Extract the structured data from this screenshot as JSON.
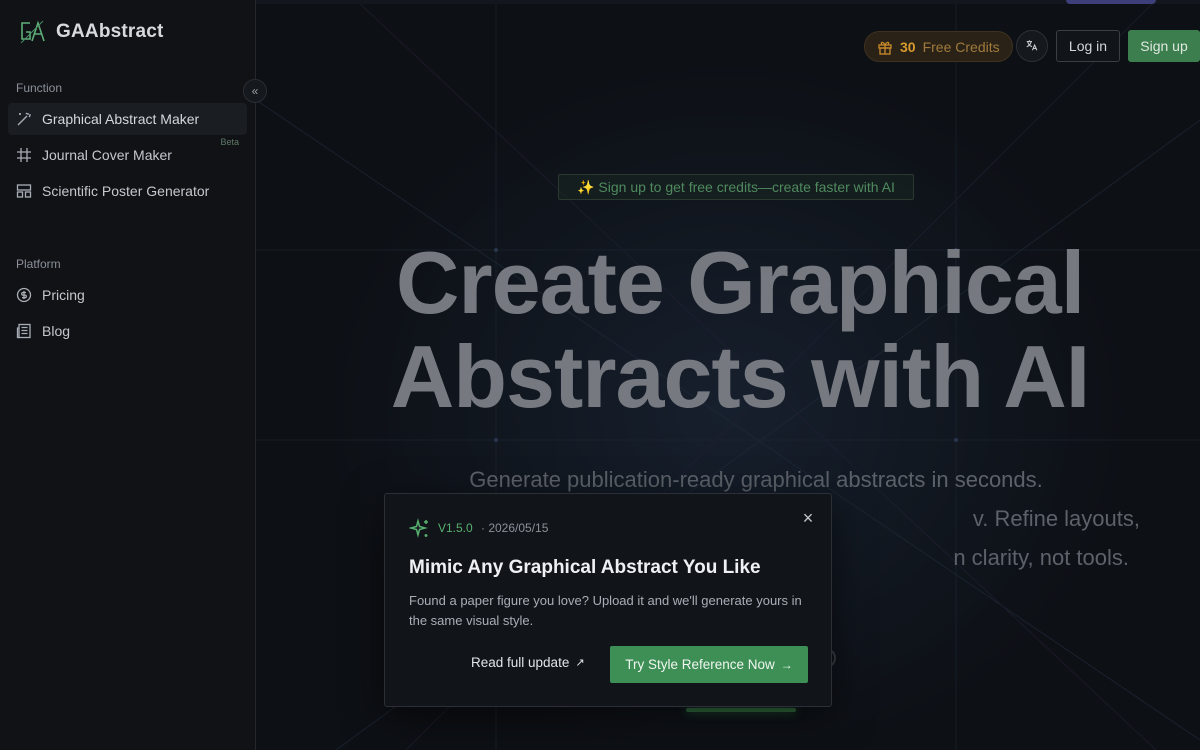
{
  "brand": {
    "name": "GAAbstract",
    "logo": "ga-logo-icon"
  },
  "sidebar": {
    "function_label": "Function",
    "function_items": [
      {
        "label": "Graphical Abstract Maker",
        "icon": "magic-wand-icon",
        "active": true
      },
      {
        "label": "Journal Cover Maker",
        "icon": "hash-frame-icon",
        "badge": "Beta"
      },
      {
        "label": "Scientific Poster Generator",
        "icon": "layout-icon"
      }
    ],
    "platform_label": "Platform",
    "platform_items": [
      {
        "label": "Pricing",
        "icon": "dollar-circle-icon"
      },
      {
        "label": "Blog",
        "icon": "newspaper-icon"
      }
    ],
    "collapse_icon": "«"
  },
  "header": {
    "credits_count": "30",
    "credits_label": "Free Credits",
    "language_icon": "translate-icon",
    "login_label": "Log in",
    "signup_label": "Sign up"
  },
  "hero": {
    "promo": "✨ Sign up to get free credits—create faster with AI",
    "title_line1": "Create Graphical",
    "title_line2": "Abstracts with AI",
    "subtitle_line1": "Generate publication-ready graphical abstracts in seconds.",
    "subtitle_line2": "v. Refine layouts,",
    "subtitle_line3": "n clarity, not tools."
  },
  "modal": {
    "version": "V1.5.0",
    "date": "· 2026/05/15",
    "title": "Mimic Any Graphical Abstract You Like",
    "description": "Found a paper figure you love? Upload it and we'll generate yours in the same visual style.",
    "read_label": "Read full update",
    "read_icon": "↗",
    "cta_label": "Try Style Reference Now",
    "cta_icon": "→",
    "close_icon": "×"
  },
  "colors": {
    "accent": "#3d8f55",
    "credits": "#d79a2f",
    "background": "#0b0d12"
  }
}
